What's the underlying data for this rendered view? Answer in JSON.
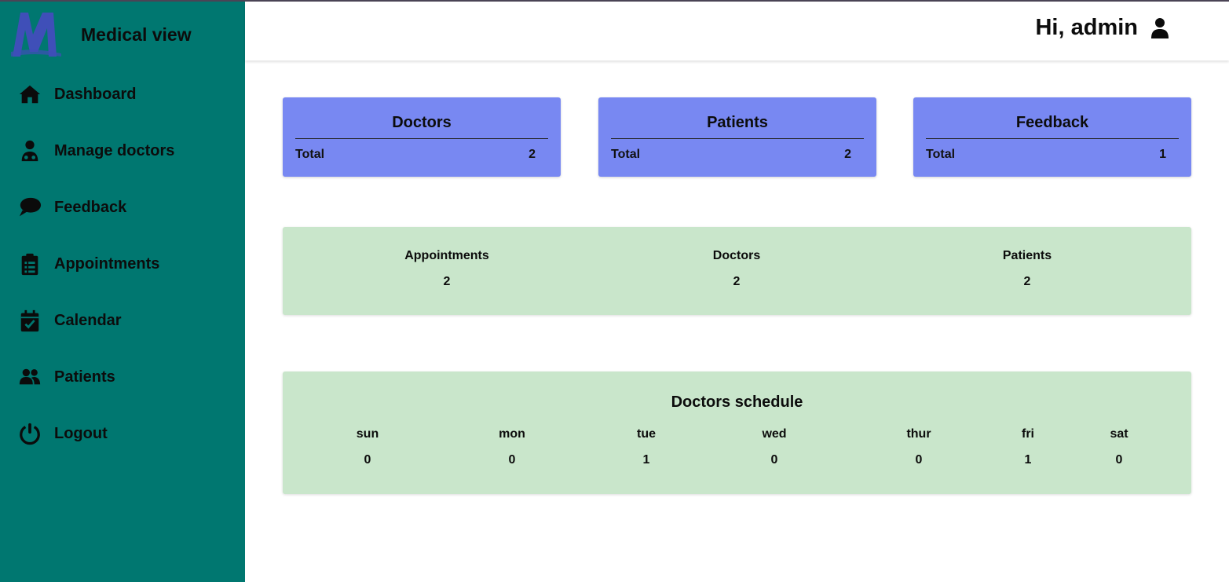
{
  "brand": {
    "title": "Medical view"
  },
  "sidebar": {
    "items": [
      {
        "label": "Dashboard",
        "icon": "home-icon"
      },
      {
        "label": "Manage doctors",
        "icon": "doctor-icon"
      },
      {
        "label": "Feedback",
        "icon": "comment-icon"
      },
      {
        "label": "Appointments",
        "icon": "clipboard-list-icon"
      },
      {
        "label": "Calendar",
        "icon": "calendar-check-icon"
      },
      {
        "label": "Patients",
        "icon": "users-icon"
      },
      {
        "label": "Logout",
        "icon": "power-icon"
      }
    ]
  },
  "header": {
    "greeting": "Hi, admin",
    "icon": "user-icon"
  },
  "cards": [
    {
      "title": "Doctors",
      "total_label": "Total",
      "total": "2"
    },
    {
      "title": "Patients",
      "total_label": "Total",
      "total": "2"
    },
    {
      "title": "Feedback",
      "total_label": "Total",
      "total": "1"
    }
  ],
  "summary": [
    {
      "label": "Appointments",
      "value": "2"
    },
    {
      "label": "Doctors",
      "value": "2"
    },
    {
      "label": "Patients",
      "value": "2"
    }
  ],
  "schedule": {
    "title": "Doctors schedule",
    "days": [
      {
        "label": "sun",
        "value": "0"
      },
      {
        "label": "mon",
        "value": "0"
      },
      {
        "label": "tue",
        "value": "1"
      },
      {
        "label": "wed",
        "value": "0"
      },
      {
        "label": "thur",
        "value": "0"
      },
      {
        "label": "fri",
        "value": "1"
      },
      {
        "label": "sat",
        "value": "0"
      }
    ]
  },
  "colors": {
    "sidebar": "#007770",
    "card": "#7888f2",
    "panel": "#c9e6cb",
    "logo": "#3f4fb8"
  }
}
